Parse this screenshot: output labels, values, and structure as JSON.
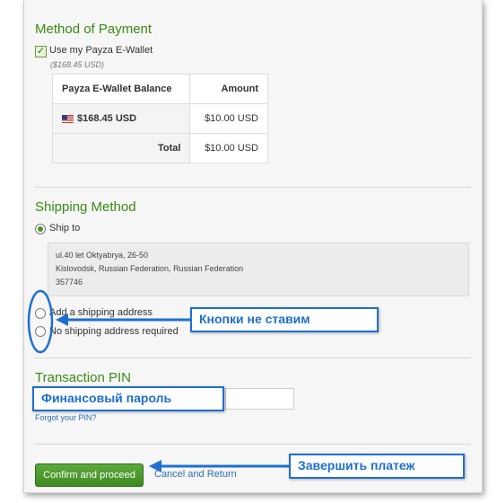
{
  "payment": {
    "title": "Method of Payment",
    "wallet_checkbox_label": "Use my Payza E-Wallet",
    "wallet_balance_note": "($168.45 USD)",
    "table": {
      "headers": [
        "Payza E-Wallet Balance",
        "Amount"
      ],
      "rows": [
        {
          "balance": "$168.45 USD",
          "amount": "$10.00 USD"
        },
        {
          "label": "Total",
          "amount": "$10.00 USD"
        }
      ]
    }
  },
  "shipping": {
    "title": "Shipping Method",
    "ship_to_label": "Ship to",
    "address_lines": [
      "ul.40 let Oktyabrya, 26-50",
      "Kislovodsk, Russian Federation, Russian Federation",
      "357746"
    ],
    "option_add": "Add a shipping address",
    "option_none": "No shipping address required"
  },
  "pin": {
    "title": "Transaction PIN",
    "forgot_link": "Forgot your PIN?"
  },
  "actions": {
    "confirm_label": "Confirm and proceed",
    "cancel_label": "Cancel and Return"
  },
  "annotations": {
    "no_buttons": "Кнопки не ставим",
    "financial_password": "Финансовый пароль",
    "complete_payment": "Завершить платеж"
  },
  "colors": {
    "accent_green": "#3a8a12",
    "annotation_blue": "#1e6fd0",
    "link_blue": "#2e6fb2"
  }
}
